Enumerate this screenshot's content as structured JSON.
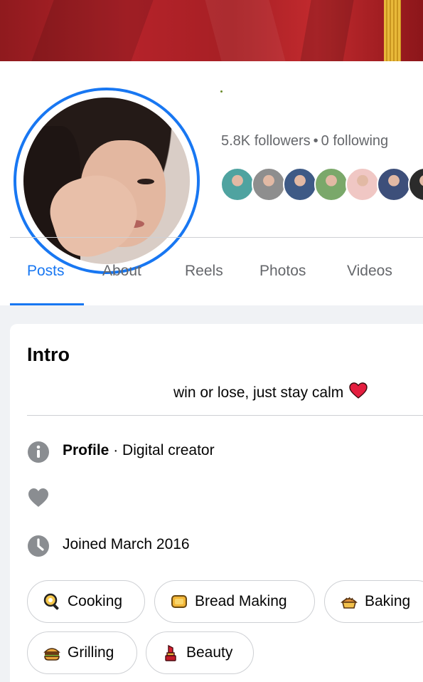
{
  "profile": {
    "followers_text": "5.8K followers",
    "separator": "•",
    "following_text": "0 following",
    "friend_avatars": [
      {
        "name": "friend-avatar-1",
        "color": "#4fa3a0"
      },
      {
        "name": "friend-avatar-2",
        "color": "#8e8e8e"
      },
      {
        "name": "friend-avatar-3",
        "color": "#3e5a86"
      },
      {
        "name": "friend-avatar-4",
        "color": "#7aa86a"
      },
      {
        "name": "friend-avatar-5",
        "color": "#f0c7c4"
      },
      {
        "name": "friend-avatar-6",
        "color": "#3d4f7a"
      },
      {
        "name": "friend-avatar-7",
        "color": "#2b2b2b"
      }
    ]
  },
  "tabs": [
    {
      "label": "Posts",
      "active": true
    },
    {
      "label": "About",
      "active": false
    },
    {
      "label": "Reels",
      "active": false
    },
    {
      "label": "Photos",
      "active": false
    },
    {
      "label": "Videos",
      "active": false
    }
  ],
  "intro": {
    "title": "Intro",
    "bio": "win or lose, just stay calm",
    "profile_label": "Profile",
    "profile_separator": " · ",
    "profile_category": "Digital creator",
    "joined": "Joined March 2016",
    "hobbies": [
      {
        "label": "Cooking",
        "icon": "magnifier-pan-icon"
      },
      {
        "label": "Bread Making",
        "icon": "bread-icon"
      },
      {
        "label": "Baking",
        "icon": "pie-icon"
      },
      {
        "label": "Grilling",
        "icon": "burger-icon"
      },
      {
        "label": "Beauty",
        "icon": "lipstick-icon"
      }
    ]
  },
  "colors": {
    "accent": "#1877f2",
    "secondary_text": "#65676b",
    "heart_red": "#e41e3f",
    "icon_gray": "#8a8d91"
  }
}
